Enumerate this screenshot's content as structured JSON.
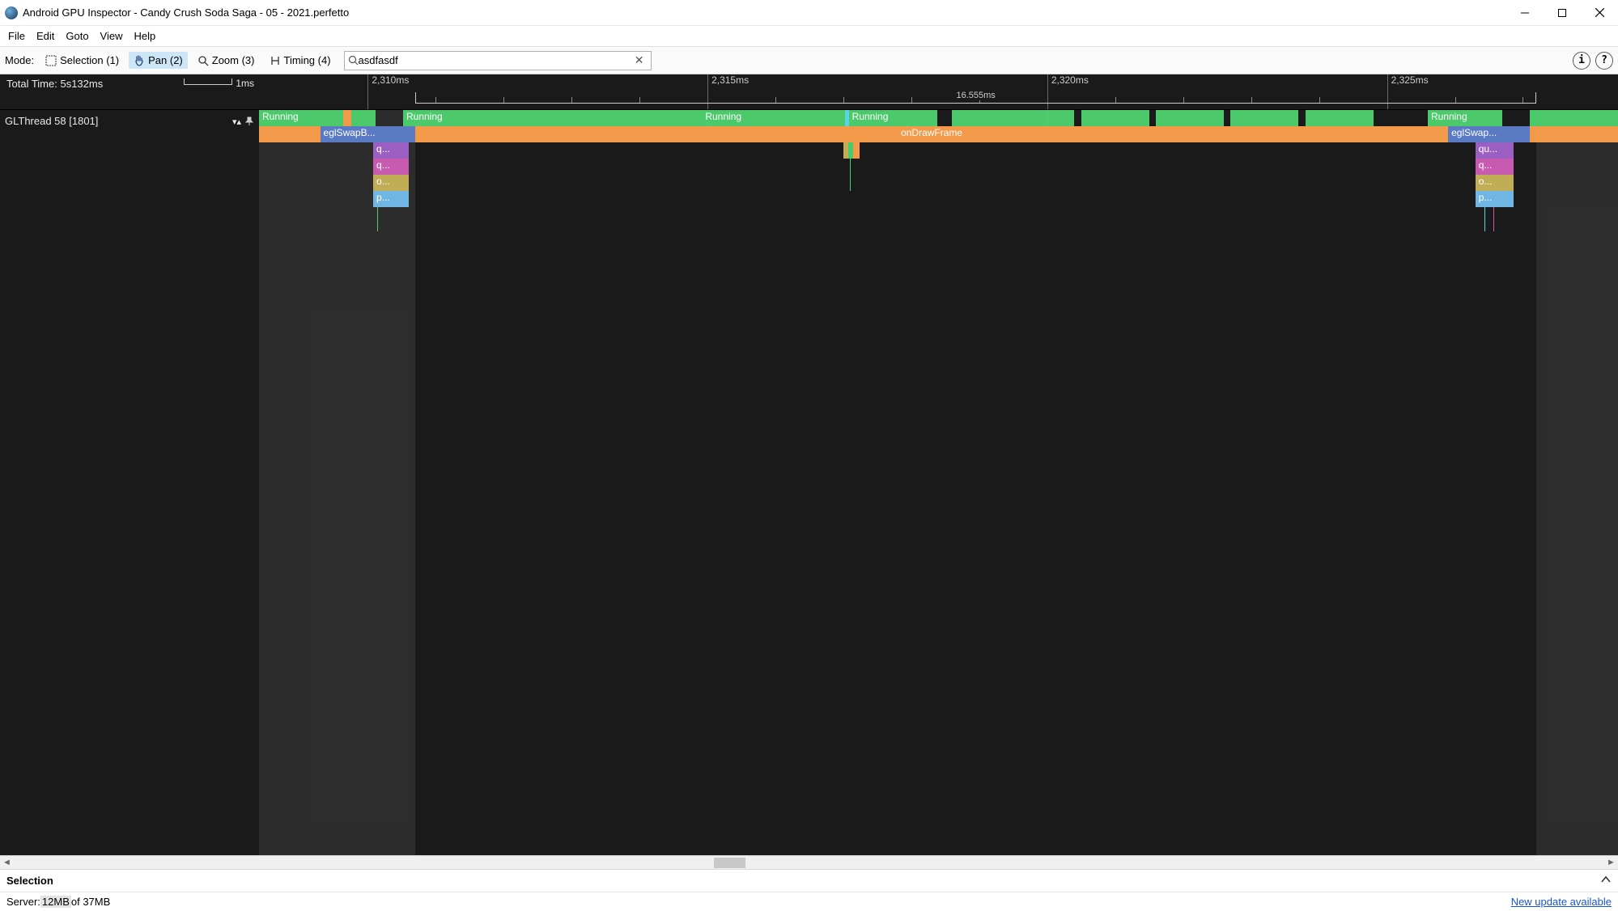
{
  "title": "Android GPU Inspector - Candy Crush Soda Saga - 05 - 2021.perfetto",
  "menu": {
    "file": "File",
    "edit": "Edit",
    "goto": "Goto",
    "view": "View",
    "help": "Help"
  },
  "toolbar": {
    "mode_label": "Mode:",
    "selection": "Selection (1)",
    "pan": "Pan (2)",
    "zoom": "Zoom (3)",
    "timing": "Timing (4)",
    "search_value": "asdfasdf",
    "info_btn": "i",
    "help_btn": "?"
  },
  "timeline": {
    "total_time": "Total Time: 5s132ms",
    "scale_label": "1ms",
    "ticks": [
      "2,310ms",
      "2,315ms",
      "2,320ms",
      "2,325ms"
    ],
    "frame_span": "16.555ms",
    "thread_label": "GLThread 58 [1801]",
    "slices": {
      "running": "Running",
      "eglSwapB": "eglSwapB...",
      "eglSwap2": "eglSwap...",
      "onDrawFrame": "onDrawFrame",
      "q": "q...",
      "qu": "qu...",
      "o": "o...",
      "p": "p..."
    },
    "colors": {
      "running": "#4bc96b",
      "orange": "#f2994a",
      "blue": "#5a7ac4",
      "cyan": "#58d4e5",
      "purple": "#9b5fc3",
      "magenta": "#c85bb0",
      "olive": "#c0ad56",
      "sky": "#6fb6e5"
    }
  },
  "bottom": {
    "selection_label": "Selection",
    "server_prefix": "Server: ",
    "mem_used": "12MB",
    "mem_of": " of 37MB",
    "update_link": "New update available"
  }
}
